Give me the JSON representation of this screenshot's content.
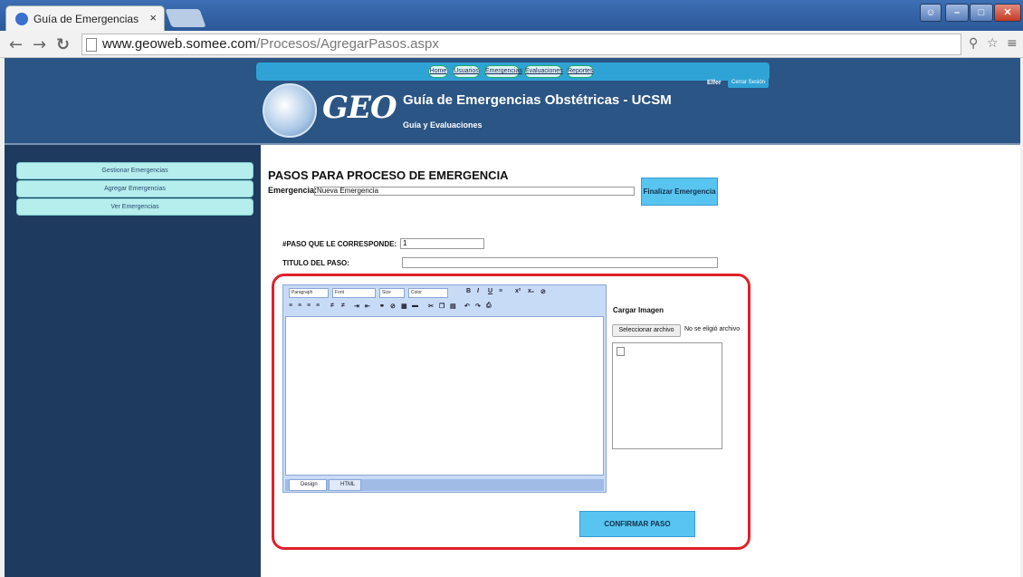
{
  "browser": {
    "tab_title": "Guía de Emergencias Obst",
    "tab_close": "×",
    "url_host": "www.geoweb.somee.com",
    "url_path": "/Procesos/AgregarPasos.aspx"
  },
  "header": {
    "nav": [
      "Home",
      "Usuarios",
      "Emergencias",
      "Evaluaciones",
      "Reportes"
    ],
    "logo_text": "GEO",
    "site_title": "Guía de Emergencias Obstétricas - UCSM",
    "site_subtitle": "Guía y Evaluaciones",
    "user": "Elfer",
    "logout": "Cerrar Sesión"
  },
  "sidebar": {
    "items": [
      "Gestionar Emergencias",
      "Agregar Emergencias",
      "Ver Emergencias"
    ]
  },
  "main": {
    "heading": "PASOS PARA PROCESO DE EMERGENCIA",
    "emergencia_label": "Emergencia:",
    "emergencia_value": "Nueva Emergencia",
    "finalizar": "Finalizar Emergencia",
    "paso_label": "#PASO QUE LE CORRESPONDE:",
    "paso_value": "1",
    "titulo_label": "TITULO DEL PASO:",
    "titulo_value": ""
  },
  "editor": {
    "paragraph": "Paragraph",
    "font": "Font",
    "size": "Size",
    "color": "Color",
    "design_tab": "Design",
    "html_tab": "HTML"
  },
  "image": {
    "label": "Cargar Imagen",
    "select_button": "Seleccionar archivo",
    "no_file": "No se eligió archivo"
  },
  "actions": {
    "confirm": "CONFIRMAR PASO"
  },
  "colors": {
    "banner": "#2b5584",
    "accent": "#58c4f0",
    "highlight": "#e0202c"
  }
}
